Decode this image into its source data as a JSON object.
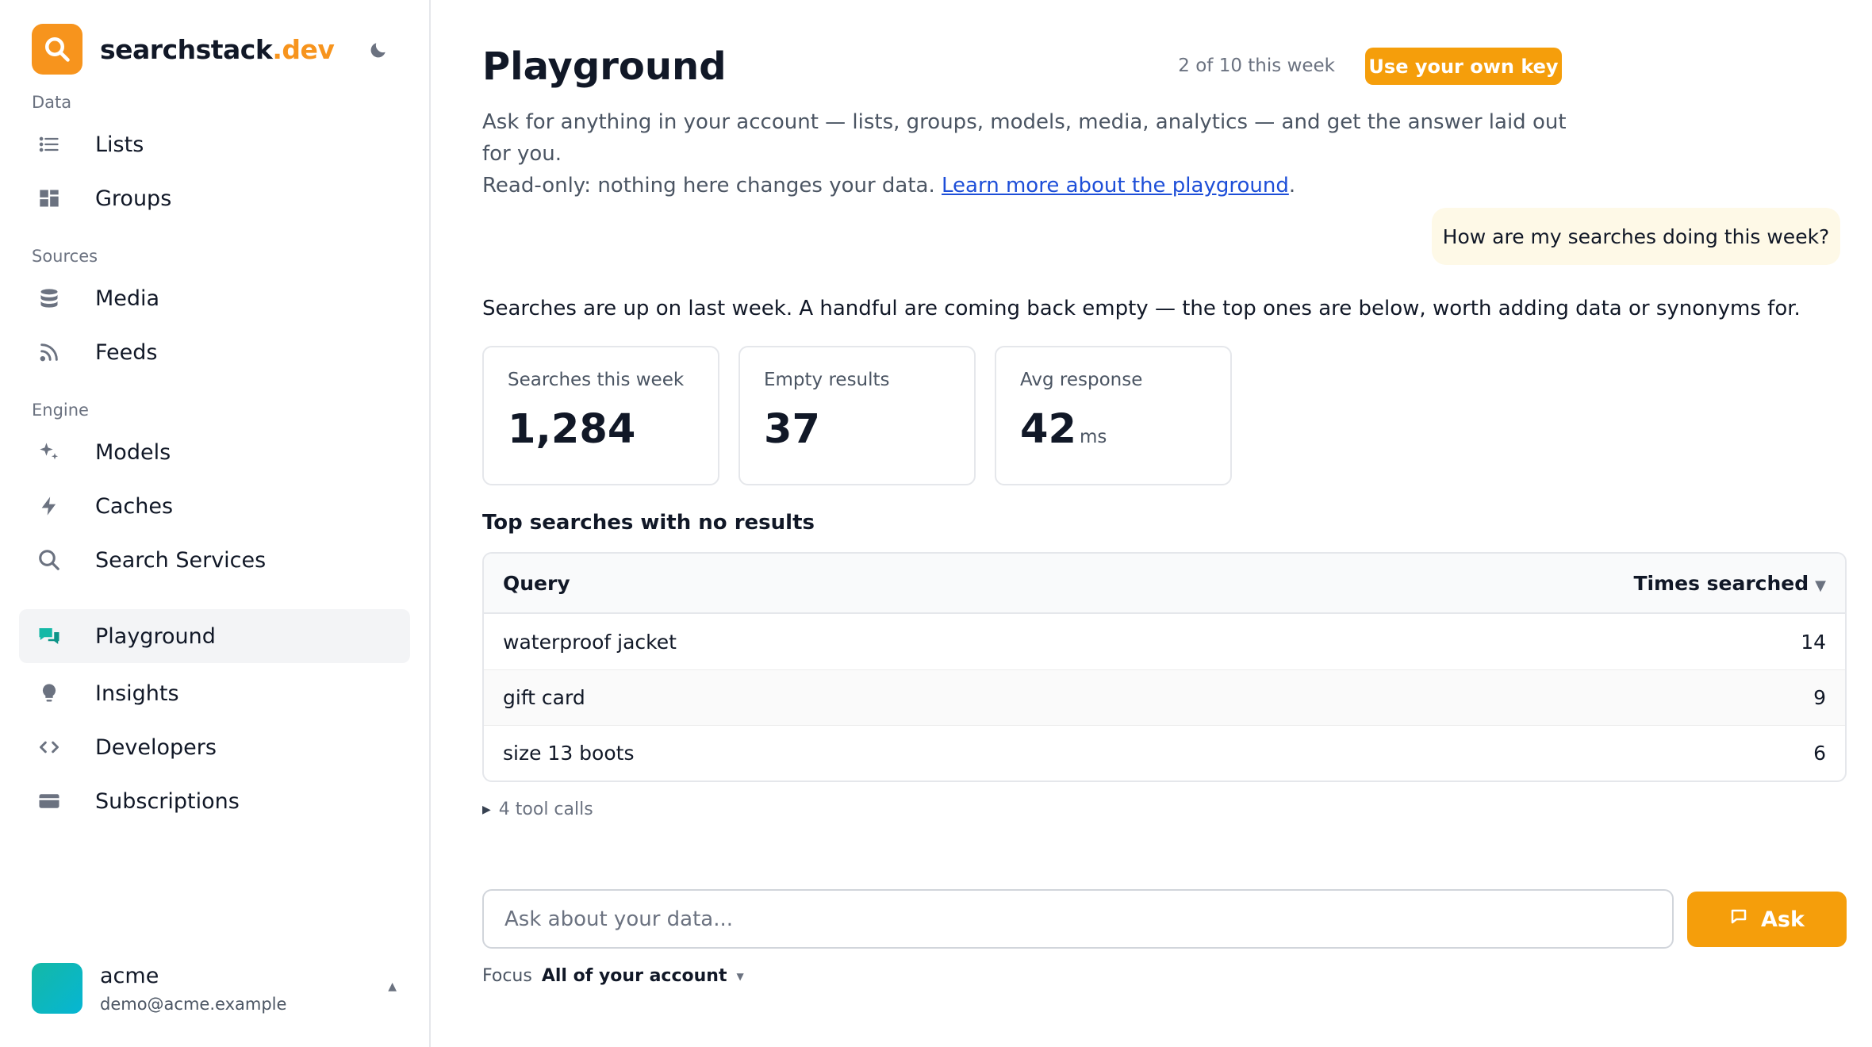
{
  "brand": {
    "name": "searchstack",
    "tld": ".dev",
    "accent": "#f7941d"
  },
  "sidebar": {
    "sections": [
      {
        "label": "Data",
        "items": [
          {
            "label": "Lists",
            "icon": "list-icon"
          },
          {
            "label": "Groups",
            "icon": "grid-icon"
          }
        ]
      },
      {
        "label": "Sources",
        "items": [
          {
            "label": "Media",
            "icon": "database-icon"
          },
          {
            "label": "Feeds",
            "icon": "rss-icon"
          }
        ]
      },
      {
        "label": "Engine",
        "items": [
          {
            "label": "Models",
            "icon": "sparkles-icon"
          },
          {
            "label": "Caches",
            "icon": "bolt-icon"
          },
          {
            "label": "Search Services",
            "icon": "search-icon"
          }
        ]
      }
    ],
    "bottom_items": [
      {
        "label": "Playground",
        "icon": "chat-icon",
        "active": true
      },
      {
        "label": "Insights",
        "icon": "lightbulb-icon"
      },
      {
        "label": "Developers",
        "icon": "code-icon"
      },
      {
        "label": "Subscriptions",
        "icon": "credit-card-icon"
      }
    ],
    "account": {
      "name": "acme",
      "email": "demo@acme.example"
    }
  },
  "main": {
    "title": "Playground",
    "quota": "2 of 10 this week",
    "own_key_label": "Use your own key",
    "desc_line1": "Ask for anything in your account — lists, groups, models, media, analytics — and get the answer laid out for you.",
    "desc_line2": "Read-only: nothing here changes your data.",
    "learn_more": "Learn more about the playground",
    "user_message": "How are my searches doing this week?",
    "answer": "Searches are up on last week. A handful are coming back empty — the top ones are below, worth adding data or synonyms for.",
    "cards": [
      {
        "label": "Searches this week",
        "value": "1,284",
        "unit": ""
      },
      {
        "label": "Empty results",
        "value": "37",
        "unit": ""
      },
      {
        "label": "Avg response",
        "value": "42",
        "unit": "ms"
      }
    ],
    "table": {
      "title": "Top searches with no results",
      "headers": {
        "query": "Query",
        "times": "Times searched"
      },
      "rows": [
        {
          "query": "waterproof jacket",
          "times": "14"
        },
        {
          "query": "gift card",
          "times": "9"
        },
        {
          "query": "size 13 boots",
          "times": "6"
        }
      ]
    },
    "tool_calls": "4 tool calls",
    "input_placeholder": "Ask about your data...",
    "ask_label": "Ask",
    "focus_label": "Focus",
    "focus_value": "All of your account"
  }
}
